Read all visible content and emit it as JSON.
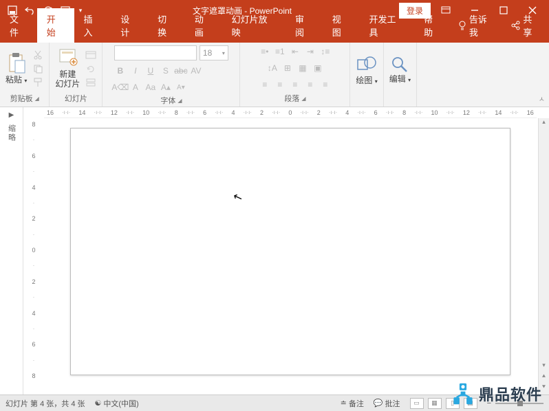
{
  "title": "文字遮罩动画 - PowerPoint",
  "login": "登录",
  "tabs": {
    "file": "文件",
    "home": "开始",
    "insert": "插入",
    "design": "设计",
    "transitions": "切换",
    "animations": "动画",
    "slideshow": "幻灯片放映",
    "review": "审阅",
    "view": "视图",
    "developer": "开发工具",
    "help": "帮助",
    "tellme": "告诉我",
    "share": "共享"
  },
  "ribbon": {
    "clipboard": {
      "label": "剪贴板",
      "paste": "粘贴"
    },
    "slides": {
      "label": "幻灯片",
      "newslide": "新建\n幻灯片"
    },
    "font": {
      "label": "字体",
      "size": "18"
    },
    "paragraph": {
      "label": "段落"
    },
    "drawing": {
      "label": "绘图"
    },
    "editing": {
      "label": "编辑"
    }
  },
  "outline_label": "缩略",
  "h_ruler": [
    "16",
    "14",
    "12",
    "10",
    "8",
    "6",
    "4",
    "2",
    "0",
    "2",
    "4",
    "6",
    "8",
    "10",
    "12",
    "14",
    "16"
  ],
  "v_ruler": [
    "8",
    "6",
    "4",
    "2",
    "0",
    "2",
    "4",
    "6",
    "8"
  ],
  "status": {
    "slide_info": "幻灯片 第 4 张，共 4 张",
    "lang_icon": "☯",
    "lang": "中文(中国)",
    "notes": "备注",
    "comments": "批注"
  },
  "watermark": "鼎品软件"
}
